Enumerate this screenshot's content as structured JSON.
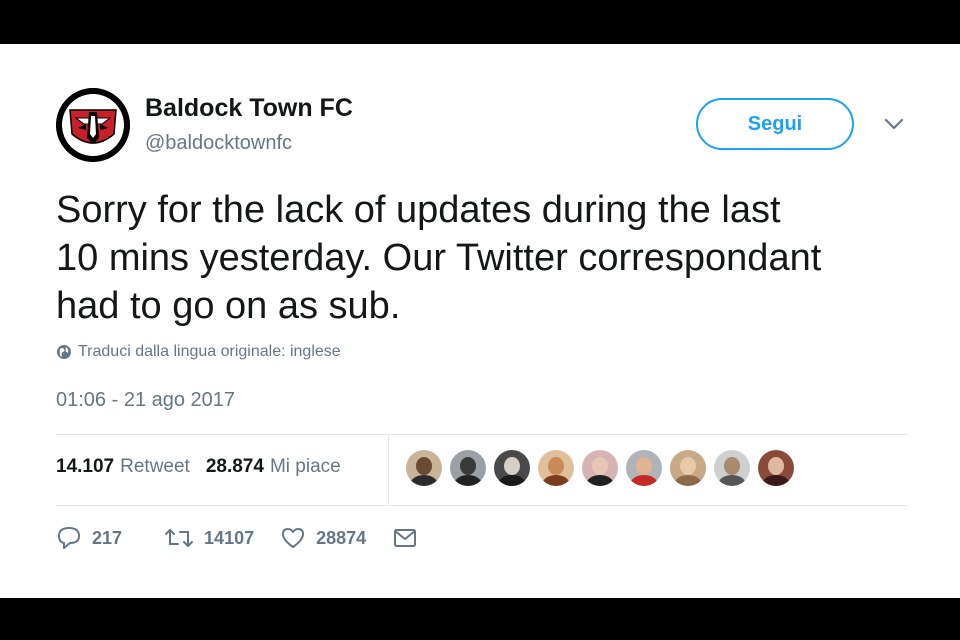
{
  "tweet": {
    "display_name": "Baldock Town FC",
    "handle": "@baldocktownfc",
    "follow_label": "Segui",
    "text_lines": [
      "Sorry for the lack of updates during the last",
      "10 mins yesterday. Our Twitter correspondant",
      "had to go on as sub."
    ],
    "translate_label": "Traduci dalla lingua originale: inglese",
    "timestamp": "01:06 - 21 ago 2017"
  },
  "stats": {
    "retweets_count": "14.107",
    "retweets_label": "Retweet",
    "likes_count": "28.874",
    "likes_label": "Mi piace"
  },
  "likers": [
    {
      "bg": "#c9b49a",
      "skin": "#6b4a33",
      "shirt": "#2b2b2b"
    },
    {
      "bg": "#9aa0a6",
      "skin": "#3a3a3a",
      "shirt": "#222222"
    },
    {
      "bg": "#4a4a4a",
      "skin": "#d8cfc7",
      "shirt": "#1a1a1a"
    },
    {
      "bg": "#e0c09a",
      "skin": "#c98a5a",
      "shirt": "#7a3b1e"
    },
    {
      "bg": "#d7b3b3",
      "skin": "#e7c6b4",
      "shirt": "#222222"
    },
    {
      "bg": "#b0b4b8",
      "skin": "#e0b394",
      "shirt": "#c62828"
    },
    {
      "bg": "#c7a98a",
      "skin": "#e8c9a8",
      "shirt": "#8a6a4a"
    },
    {
      "bg": "#cfcfcf",
      "skin": "#a88a6e",
      "shirt": "#555555"
    },
    {
      "bg": "#8a4a3a",
      "skin": "#e0b8a0",
      "shirt": "#3a1a1a"
    }
  ],
  "actions": {
    "replies": "217",
    "retweets": "14107",
    "likes": "28874"
  },
  "colors": {
    "accent": "#1da1f2",
    "secondary_text": "#657786",
    "primary_text": "#14171a",
    "crest_red": "#c8202a"
  },
  "icons": [
    "globe-icon",
    "chevron-down-icon",
    "reply-icon",
    "retweet-icon",
    "heart-icon",
    "envelope-icon"
  ]
}
